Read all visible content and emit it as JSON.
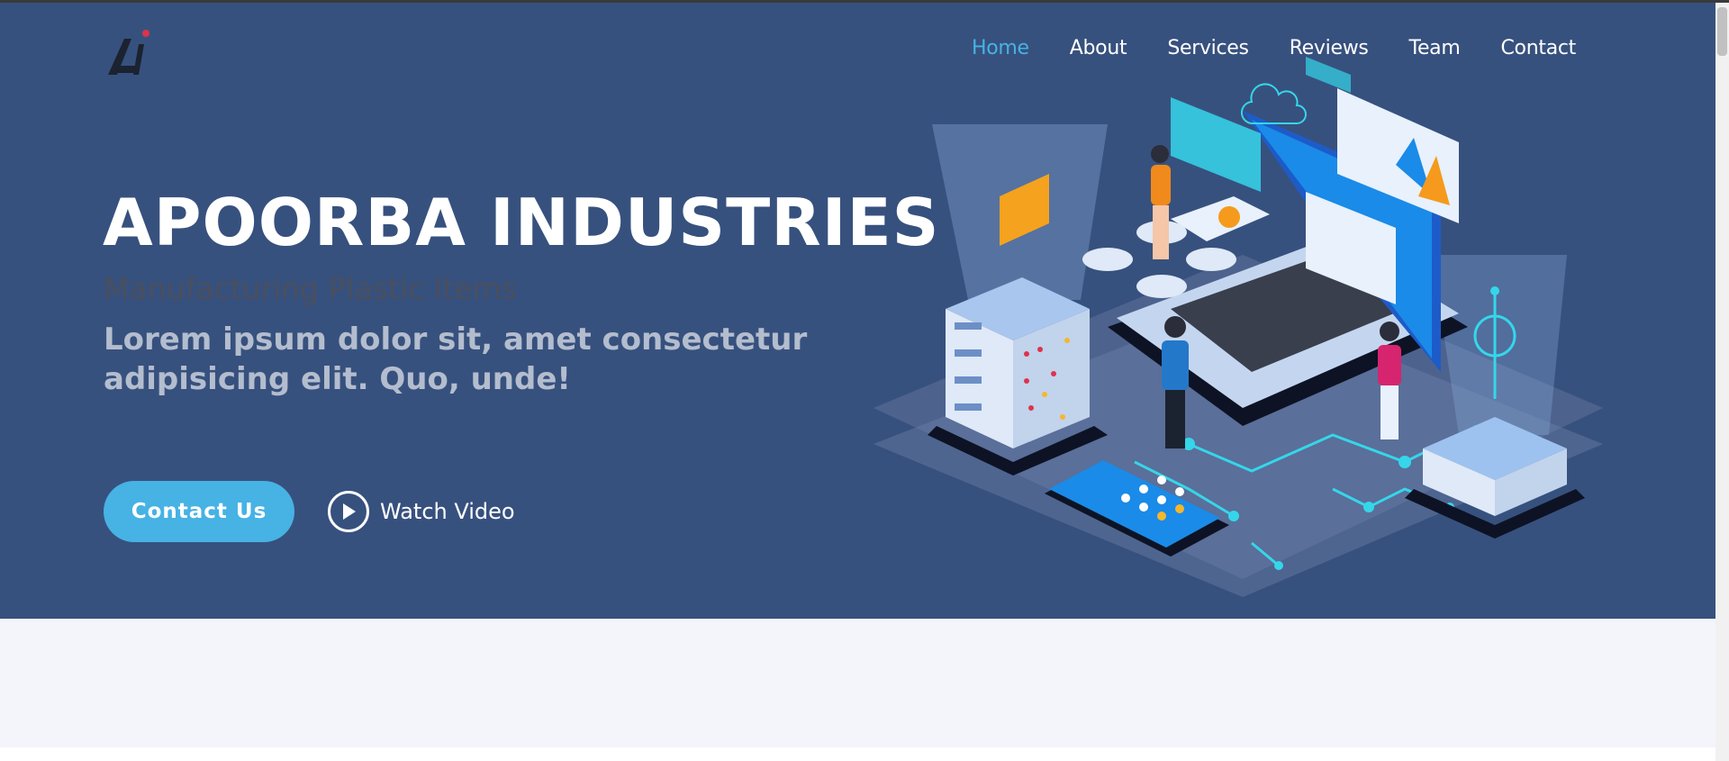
{
  "brand": {
    "logo": "AI",
    "logo_icon": "ai-monogram-logo"
  },
  "nav": {
    "items": [
      {
        "label": "Home",
        "active": true
      },
      {
        "label": "About",
        "active": false
      },
      {
        "label": "Services",
        "active": false
      },
      {
        "label": "Reviews",
        "active": false
      },
      {
        "label": "Team",
        "active": false
      },
      {
        "label": "Contact",
        "active": false
      }
    ]
  },
  "hero": {
    "title": "APOORBA INDUSTRIES",
    "subtitle": "Manufacturing Plastic Items",
    "lead": "Lorem ipsum dolor sit, amet consectetur adipisicing elit. Quo, unde!",
    "cta_label": "Contact Us",
    "video_label": "Watch Video",
    "video_icon": "play-circle-icon",
    "illustration_icon": "isometric-tech-illustration"
  },
  "colors": {
    "hero_bg": "#37517e",
    "accent": "#47b2e4",
    "section_bg": "#f3f5fa"
  }
}
